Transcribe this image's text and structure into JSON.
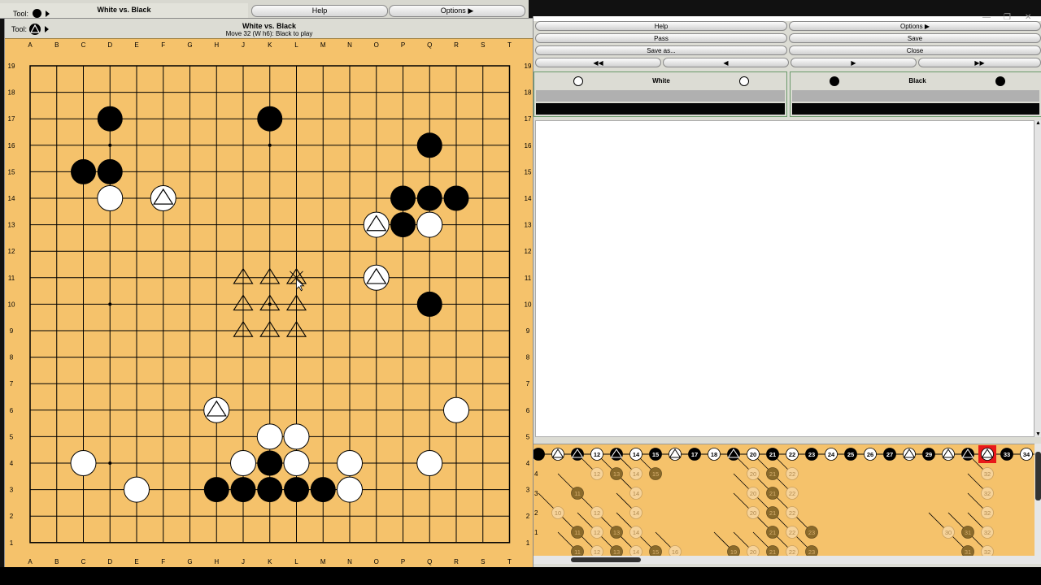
{
  "background_window": {
    "tool_label": "Tool:",
    "title": "White vs. Black",
    "buttons": [
      "Help",
      "Options"
    ]
  },
  "board_window": {
    "tool_label": "Tool:",
    "title": "White vs. Black",
    "status": "Move 32 (W h6): Black to play"
  },
  "board": {
    "columns": [
      "A",
      "B",
      "C",
      "D",
      "E",
      "F",
      "G",
      "H",
      "J",
      "K",
      "L",
      "M",
      "N",
      "O",
      "P",
      "Q",
      "R",
      "S",
      "T"
    ],
    "rows": [
      "19",
      "18",
      "17",
      "16",
      "15",
      "14",
      "13",
      "12",
      "11",
      "10",
      "9",
      "8",
      "7",
      "6",
      "5",
      "4",
      "3",
      "2",
      "1"
    ],
    "hoshi": [
      "D16",
      "K16",
      "D10",
      "K10",
      "D4"
    ],
    "black_stones": [
      "D17",
      "K17",
      "C15",
      "D15",
      "Q16",
      "P14",
      "Q14",
      "R14",
      "P13",
      "Q10",
      "K4",
      "H3",
      "J3",
      "K3",
      "L3",
      "M3"
    ],
    "white_stones": [
      "D14",
      "Q13",
      "R6",
      "C4",
      "E3",
      "K5",
      "L5",
      "J4",
      "L4",
      "N4",
      "Q4",
      "N3"
    ],
    "white_triangled": [
      "F14",
      "O13",
      "O11",
      "H6"
    ],
    "triangle_marks": [
      "J11",
      "K11",
      "L11",
      "J10",
      "K10",
      "L10",
      "J9",
      "K9",
      "L9"
    ],
    "cross_marks": [
      "L11"
    ],
    "colors": {
      "board": "#f5c26b",
      "line": "#000000"
    }
  },
  "controller": {
    "buttons": [
      {
        "label": "Help",
        "row": 0,
        "col": 0
      },
      {
        "label": "Options",
        "row": 0,
        "col": 1
      },
      {
        "label": "Pass",
        "row": 1,
        "col": 0
      },
      {
        "label": "Save",
        "row": 1,
        "col": 1
      },
      {
        "label": "Save as...",
        "row": 2,
        "col": 0
      },
      {
        "label": "Close",
        "row": 2,
        "col": 1
      }
    ],
    "players": {
      "white": {
        "name": "White"
      },
      "black": {
        "name": "Black"
      }
    },
    "nav_icons": [
      "fast-backward-icon",
      "step-back-icon",
      "step-forward-icon",
      "fast-forward-icon"
    ]
  },
  "game_tree": {
    "main_line": [
      {
        "t": "b"
      },
      {
        "t": "wt"
      },
      {
        "t": "bt"
      },
      {
        "t": "w",
        "n": "12"
      },
      {
        "t": "bt"
      },
      {
        "t": "w",
        "n": "14"
      },
      {
        "t": "b",
        "n": "15"
      },
      {
        "t": "wt"
      },
      {
        "t": "b",
        "n": "17"
      },
      {
        "t": "w",
        "n": "18"
      },
      {
        "t": "bt"
      },
      {
        "t": "w",
        "n": "20"
      },
      {
        "t": "b",
        "n": "21"
      },
      {
        "t": "w",
        "n": "22"
      },
      {
        "t": "b",
        "n": "23"
      },
      {
        "t": "w",
        "n": "24"
      },
      {
        "t": "b",
        "n": "25"
      },
      {
        "t": "w",
        "n": "26"
      },
      {
        "t": "b",
        "n": "27"
      },
      {
        "t": "wt"
      },
      {
        "t": "b",
        "n": "29"
      },
      {
        "t": "wt"
      },
      {
        "t": "bt"
      },
      {
        "t": "wt",
        "current": true
      },
      {
        "t": "b",
        "n": "33"
      },
      {
        "t": "w",
        "n": "34"
      }
    ],
    "row_labels": [
      "4",
      "3",
      "2",
      "1"
    ],
    "variations": [
      {
        "c": 3,
        "r": 1,
        "t": "w",
        "n": "12"
      },
      {
        "c": 4,
        "r": 1,
        "t": "b",
        "n": "13"
      },
      {
        "c": 5,
        "r": 1,
        "t": "w",
        "n": "14"
      },
      {
        "c": 6,
        "r": 1,
        "t": "b",
        "n": "15"
      },
      {
        "c": 5,
        "r": 2,
        "t": "w",
        "n": "14"
      },
      {
        "c": 2,
        "r": 2,
        "t": "b",
        "n": "11"
      },
      {
        "c": 1,
        "r": 3,
        "t": "w",
        "n": "10"
      },
      {
        "c": 3,
        "r": 3,
        "t": "w",
        "n": "12"
      },
      {
        "c": 5,
        "r": 3,
        "t": "w",
        "n": "14"
      },
      {
        "c": 2,
        "r": 4,
        "t": "b",
        "n": "11"
      },
      {
        "c": 3,
        "r": 4,
        "t": "w",
        "n": "12"
      },
      {
        "c": 4,
        "r": 4,
        "t": "b",
        "n": "13"
      },
      {
        "c": 5,
        "r": 4,
        "t": "w",
        "n": "14"
      },
      {
        "c": 2,
        "r": 5,
        "t": "b",
        "n": "11"
      },
      {
        "c": 3,
        "r": 5,
        "t": "w",
        "n": "12"
      },
      {
        "c": 4,
        "r": 5,
        "t": "b",
        "n": "13"
      },
      {
        "c": 5,
        "r": 5,
        "t": "w",
        "n": "14"
      },
      {
        "c": 6,
        "r": 5,
        "t": "b",
        "n": "15"
      },
      {
        "c": 7,
        "r": 5,
        "t": "w",
        "n": "16"
      },
      {
        "c": 11,
        "r": 1,
        "t": "w",
        "n": "20"
      },
      {
        "c": 12,
        "r": 1,
        "t": "b",
        "n": "21"
      },
      {
        "c": 13,
        "r": 1,
        "t": "w",
        "n": "22"
      },
      {
        "c": 11,
        "r": 2,
        "t": "w",
        "n": "20"
      },
      {
        "c": 12,
        "r": 2,
        "t": "b",
        "n": "21"
      },
      {
        "c": 13,
        "r": 2,
        "t": "w",
        "n": "22"
      },
      {
        "c": 11,
        "r": 3,
        "t": "w",
        "n": "20"
      },
      {
        "c": 12,
        "r": 3,
        "t": "b",
        "n": "21"
      },
      {
        "c": 13,
        "r": 3,
        "t": "w",
        "n": "22"
      },
      {
        "c": 12,
        "r": 4,
        "t": "b",
        "n": "21"
      },
      {
        "c": 13,
        "r": 4,
        "t": "w",
        "n": "22"
      },
      {
        "c": 14,
        "r": 4,
        "t": "b",
        "n": "23"
      },
      {
        "c": 10,
        "r": 5,
        "t": "b",
        "n": "19"
      },
      {
        "c": 11,
        "r": 5,
        "t": "w",
        "n": "20"
      },
      {
        "c": 12,
        "r": 5,
        "t": "b",
        "n": "21"
      },
      {
        "c": 13,
        "r": 5,
        "t": "w",
        "n": "22"
      },
      {
        "c": 14,
        "r": 5,
        "t": "b",
        "n": "23"
      },
      {
        "c": 23,
        "r": 1,
        "t": "w",
        "n": "32"
      },
      {
        "c": 23,
        "r": 2,
        "t": "w",
        "n": "32"
      },
      {
        "c": 23,
        "r": 3,
        "t": "w",
        "n": "32"
      },
      {
        "c": 21,
        "r": 4,
        "t": "w",
        "n": "30"
      },
      {
        "c": 22,
        "r": 4,
        "t": "b",
        "n": "31"
      },
      {
        "c": 23,
        "r": 4,
        "t": "w",
        "n": "32"
      },
      {
        "c": 22,
        "r": 5,
        "t": "b",
        "n": "31"
      },
      {
        "c": 23,
        "r": 5,
        "t": "w",
        "n": "32"
      }
    ]
  }
}
